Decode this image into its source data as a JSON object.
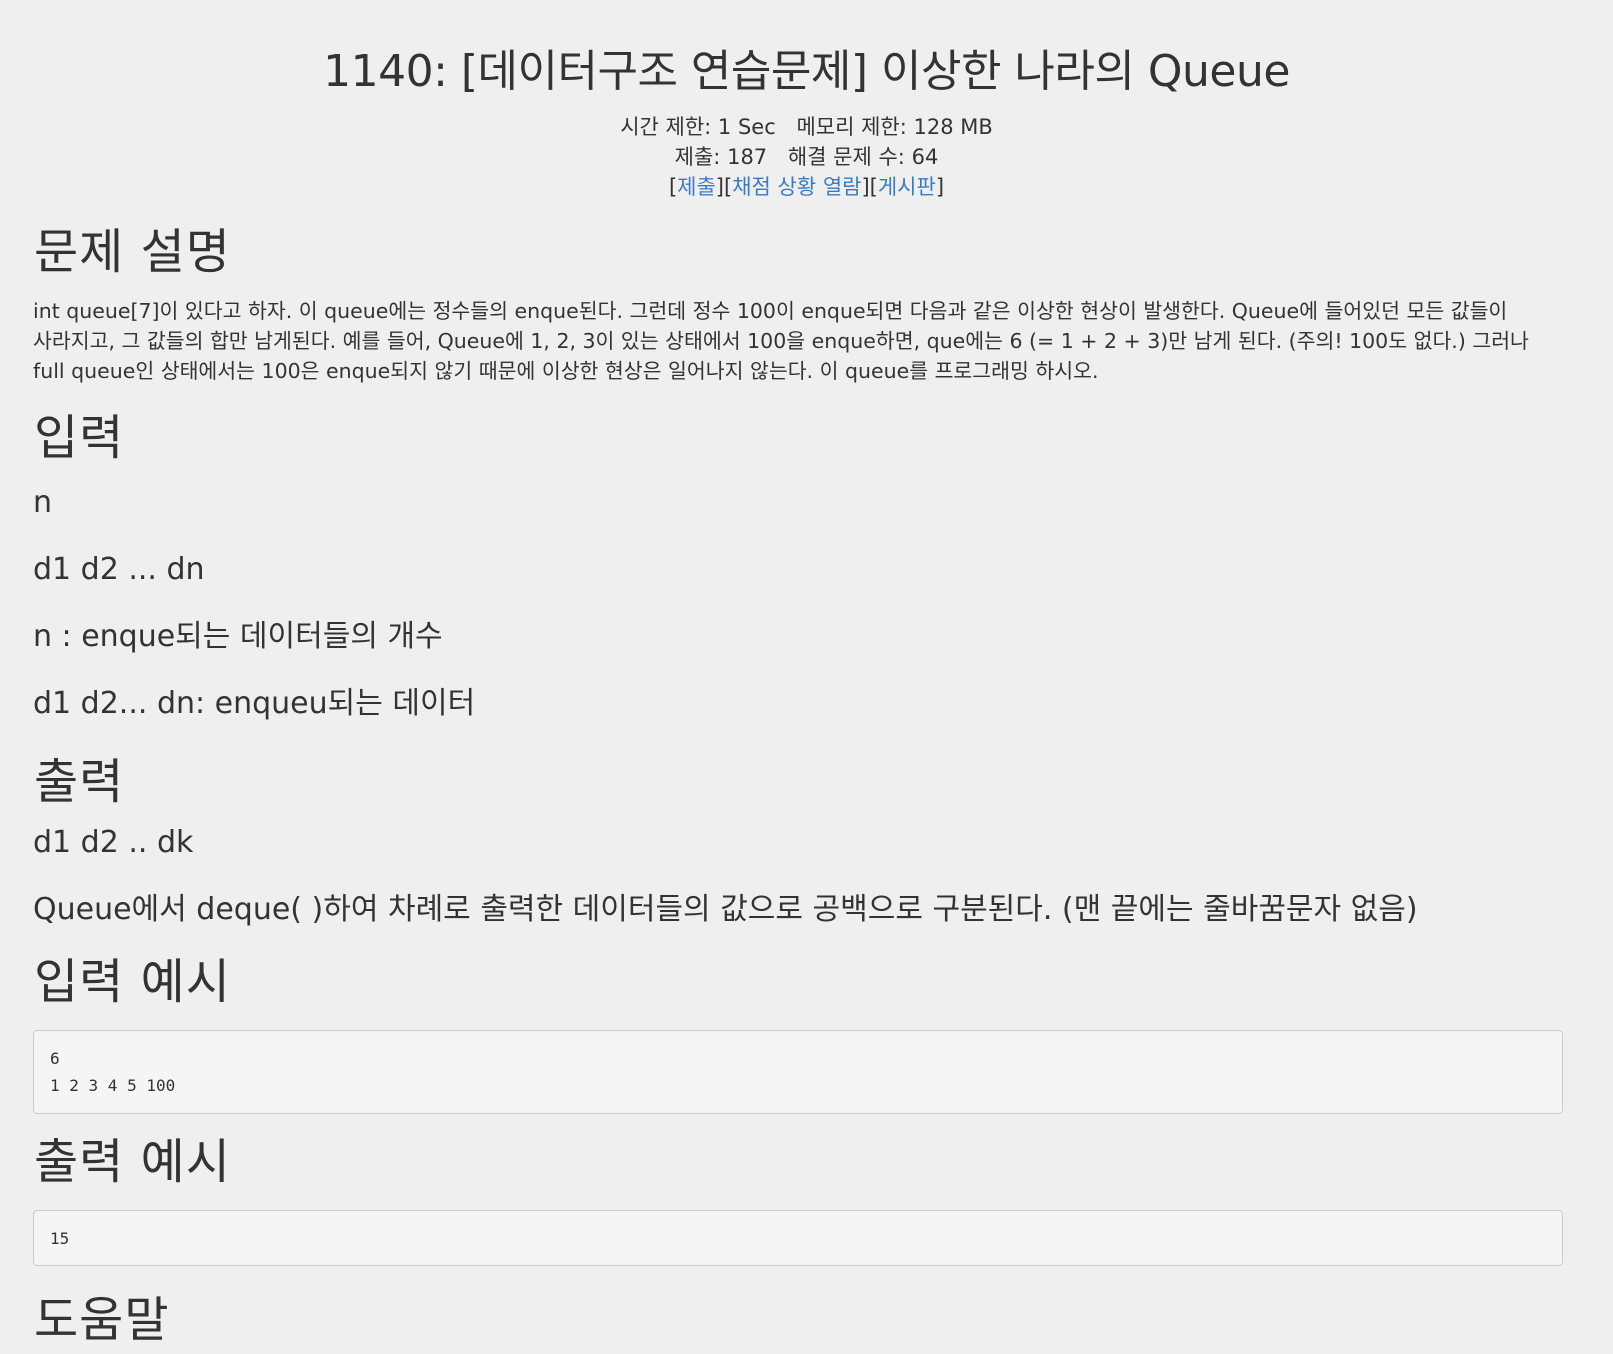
{
  "problem": {
    "title": "1140: [데이터구조 연습문제] 이상한 나라의 Queue",
    "time_limit_label": "시간 제한:",
    "time_limit_value": "1 Sec",
    "memory_limit_label": "메모리 제한:",
    "memory_limit_value": "128 MB",
    "submissions_label": "제출:",
    "submissions_value": "187",
    "solved_label": "해결 문제 수:",
    "solved_value": "64"
  },
  "links": {
    "open": "[",
    "submit": "제출",
    "sep1": "][",
    "status": "채점 상황 열람",
    "sep2": "][",
    "board": "게시판",
    "close": "]"
  },
  "sections": {
    "description": {
      "heading": "문제 설명",
      "lines": [
        "int queue[7]이 있다고 하자. 이 queue에는 정수들의 enque된다. 그런데 정수 100이 enque되면 다음과 같은 이상한 현상이 발생한다. Queue에 들어있던 모든 값들이",
        "사라지고, 그 값들의 합만 남게된다. 예를 들어, Queue에 1, 2, 3이 있는 상태에서 100을 enque하면, que에는 6 (= 1 + 2 + 3)만 남게 된다. (주의! 100도 없다.) 그러나",
        "full queue인 상태에서는 100은 enque되지 않기 때문에 이상한 현상은 일어나지 않는다. 이 queue를 프로그래밍 하시오."
      ]
    },
    "input": {
      "heading": "입력",
      "paragraphs": [
        "n",
        "d1 d2 ... dn",
        "n : enque되는 데이터들의 개수",
        "d1 d2... dn: enqueu되는 데이터"
      ]
    },
    "output": {
      "heading": "출력",
      "paragraphs": [
        "d1 d2 .. dk",
        "Queue에서 deque( )하여 차례로 출력한 데이터들의 값으로 공백으로 구분된다. (맨 끝에는 줄바꿈문자 없음)"
      ]
    },
    "sample_input": {
      "heading": "입력 예시",
      "lines": [
        "6",
        "1 2 3 4 5 100"
      ]
    },
    "sample_output": {
      "heading": "출력 예시",
      "lines": [
        "15"
      ]
    },
    "hint": {
      "heading": "도움말"
    }
  },
  "colors": {
    "background": "#efefef",
    "text": "#333333",
    "link": "#3a7bc8",
    "code_bg": "#f5f5f5",
    "code_border": "#cccccc"
  }
}
